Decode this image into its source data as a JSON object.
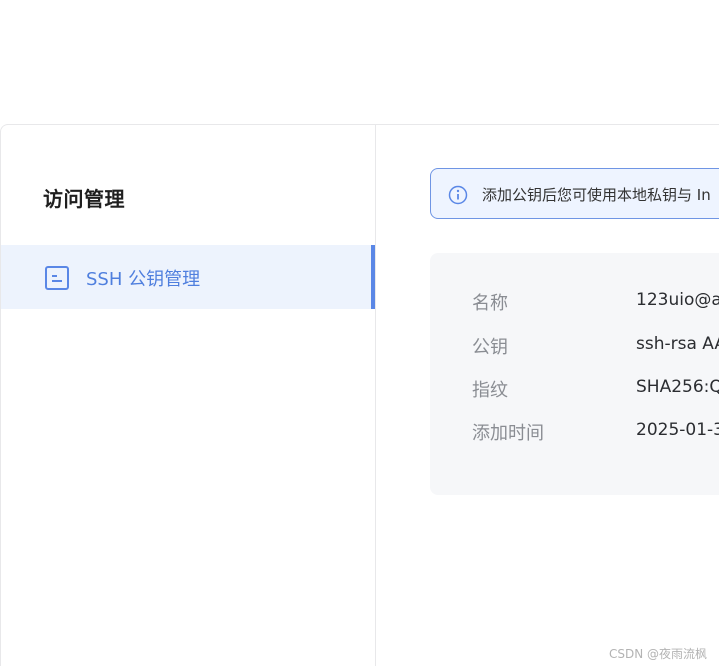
{
  "sidebar": {
    "title": "访问管理",
    "items": [
      {
        "label": "SSH 公钥管理",
        "icon": "document-icon",
        "active": true
      }
    ]
  },
  "alert": {
    "icon": "info-icon",
    "text": "添加公钥后您可使用本地私钥与 In"
  },
  "key": {
    "fields": [
      {
        "label": "名称",
        "value": "123uio@a"
      },
      {
        "label": "公钥",
        "value": "ssh-rsa AA"
      },
      {
        "label": "指纹",
        "value": "SHA256:Q"
      },
      {
        "label": "添加时间",
        "value": "2025-01-3"
      }
    ]
  },
  "watermark": "CSDN @夜雨流枫",
  "colors": {
    "accent": "#5a87e6",
    "active_bg": "#edf3fd",
    "alert_border": "#6f95e4",
    "card_bg": "#f6f7f9"
  }
}
